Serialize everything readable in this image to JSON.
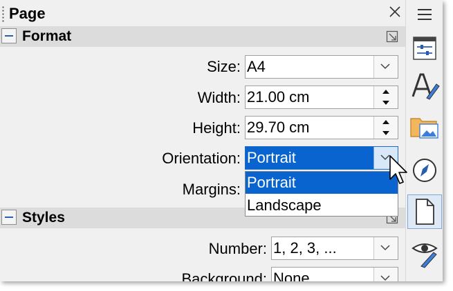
{
  "panel": {
    "title": "Page",
    "format_section": {
      "label": "Format",
      "size": {
        "label": "Size:",
        "value": "A4"
      },
      "width": {
        "label": "Width:",
        "value": "21.00 cm"
      },
      "height": {
        "label": "Height:",
        "value": "29.70 cm"
      },
      "orientation": {
        "label": "Orientation:",
        "value": "Portrait",
        "options": [
          "Portrait",
          "Landscape"
        ],
        "selected_index": 0
      },
      "margins": {
        "label": "Margins:"
      }
    },
    "styles_section": {
      "label": "Styles",
      "number": {
        "label": "Number:",
        "value": "1, 2, 3, ..."
      },
      "background": {
        "label": "Background:",
        "value": "None"
      }
    }
  },
  "sidebar": {
    "icons": [
      "menu-icon",
      "properties-icon",
      "styles-icon",
      "gallery-icon",
      "navigator-icon",
      "page-icon",
      "style-inspector-icon"
    ],
    "active": "page-icon"
  },
  "colors": {
    "selection": "#0a64cf",
    "accent": "#2a5db0",
    "active_tab": "#dfe9f5"
  }
}
